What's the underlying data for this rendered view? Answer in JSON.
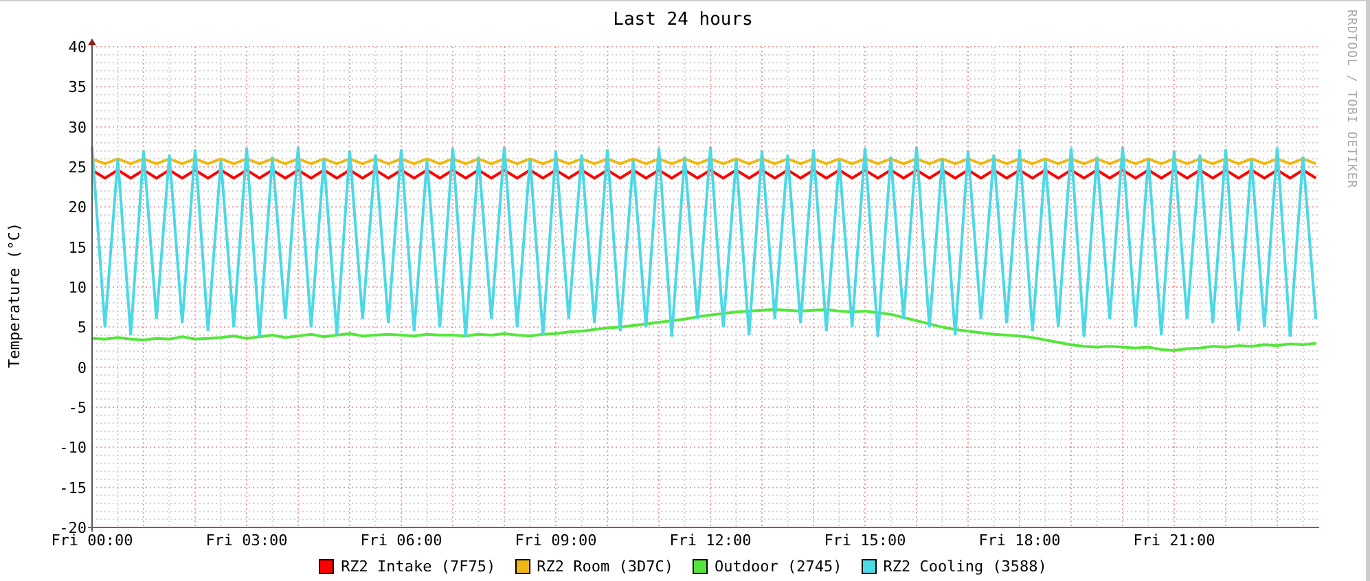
{
  "chart_data": {
    "type": "line",
    "grid": true,
    "title": "Last 24 hours",
    "ylabel": "Temperature (°C)",
    "ylim": [
      -20,
      40
    ],
    "yticks": [
      -20,
      -15,
      -10,
      -5,
      0,
      5,
      10,
      15,
      20,
      25,
      30,
      35,
      40
    ],
    "categories": [
      "Fri 00:00",
      null,
      null,
      null,
      null,
      null,
      null,
      null,
      null,
      null,
      null,
      null,
      "Fri 03:00",
      null,
      null,
      null,
      null,
      null,
      null,
      null,
      null,
      null,
      null,
      null,
      "Fri 06:00",
      null,
      null,
      null,
      null,
      null,
      null,
      null,
      null,
      null,
      null,
      null,
      "Fri 09:00",
      null,
      null,
      null,
      null,
      null,
      null,
      null,
      null,
      null,
      null,
      null,
      "Fri 12:00",
      null,
      null,
      null,
      null,
      null,
      null,
      null,
      null,
      null,
      null,
      null,
      "Fri 15:00",
      null,
      null,
      null,
      null,
      null,
      null,
      null,
      null,
      null,
      null,
      null,
      "Fri 18:00",
      null,
      null,
      null,
      null,
      null,
      null,
      null,
      null,
      null,
      null,
      null,
      "Fri 21:00",
      null,
      null,
      null,
      null,
      null,
      null,
      null,
      null,
      null,
      null,
      null
    ],
    "series": [
      {
        "name": "RZ2 Intake (7F75)",
        "color": "#ff0000",
        "values": [
          24.6,
          23.6,
          24.6,
          23.6,
          24.6,
          23.6,
          24.6,
          23.6,
          24.6,
          23.6,
          24.6,
          23.6,
          24.6,
          23.6,
          24.6,
          23.6,
          24.6,
          23.6,
          24.6,
          23.6,
          24.6,
          23.6,
          24.6,
          23.6,
          24.6,
          23.6,
          24.6,
          23.6,
          24.6,
          23.6,
          24.6,
          23.6,
          24.6,
          23.6,
          24.6,
          23.6,
          24.6,
          23.6,
          24.6,
          23.6,
          24.6,
          23.6,
          24.6,
          23.6,
          24.6,
          23.6,
          24.6,
          23.6,
          24.6,
          23.6,
          24.6,
          23.6,
          24.6,
          23.6,
          24.6,
          23.6,
          24.6,
          23.6,
          24.6,
          23.6,
          24.6,
          23.6,
          24.6,
          23.6,
          24.6,
          23.6,
          24.6,
          23.6,
          24.6,
          23.6,
          24.6,
          23.6,
          24.6,
          23.6,
          24.6,
          23.6,
          24.6,
          23.6,
          24.6,
          23.6,
          24.6,
          23.6,
          24.6,
          23.6,
          24.6,
          23.6,
          24.6,
          23.6,
          24.6,
          23.6,
          24.6,
          23.6,
          24.6,
          23.6,
          24.6,
          23.6
        ]
      },
      {
        "name": "RZ2 Room (3D7C)",
        "color": "#f0b814",
        "values": [
          26,
          25.4,
          26,
          25.4,
          26,
          25.4,
          26,
          25.4,
          26,
          25.4,
          26,
          25.4,
          26,
          25.4,
          26,
          25.4,
          26,
          25.4,
          26,
          25.4,
          26,
          25.4,
          26,
          25.4,
          26,
          25.4,
          26,
          25.4,
          26,
          25.4,
          26,
          25.4,
          26,
          25.4,
          26,
          25.4,
          26,
          25.4,
          26,
          25.4,
          26,
          25.4,
          26,
          25.4,
          26,
          25.4,
          26,
          25.4,
          26,
          25.4,
          26,
          25.4,
          26,
          25.4,
          26,
          25.4,
          26,
          25.4,
          26,
          25.4,
          26,
          25.4,
          26,
          25.4,
          26,
          25.4,
          26,
          25.4,
          26,
          25.4,
          26,
          25.4,
          26,
          25.4,
          26,
          25.4,
          26,
          25.4,
          26,
          25.4,
          26,
          25.4,
          26,
          25.4,
          26,
          25.4,
          26,
          25.4,
          26,
          25.4,
          26,
          25.4,
          26,
          25.4,
          26,
          25.4
        ]
      },
      {
        "name": "Outdoor (2745)",
        "color": "#55e63c",
        "values": [
          3.6,
          3.5,
          3.7,
          3.5,
          3.4,
          3.6,
          3.5,
          3.8,
          3.5,
          3.6,
          3.7,
          3.9,
          3.6,
          3.8,
          4,
          3.7,
          3.9,
          4.1,
          3.8,
          4,
          4.2,
          3.9,
          4,
          4.1,
          4,
          3.9,
          4.1,
          4,
          4,
          3.9,
          4.1,
          4,
          4.2,
          4,
          3.9,
          4.1,
          4.2,
          4.4,
          4.5,
          4.7,
          4.9,
          5,
          5.2,
          5.4,
          5.6,
          5.8,
          6,
          6.3,
          6.5,
          6.7,
          6.9,
          7,
          7.1,
          7.2,
          7.1,
          7,
          7.1,
          7.2,
          7,
          6.9,
          7,
          6.8,
          6.6,
          6.2,
          5.8,
          5.4,
          5,
          4.7,
          4.5,
          4.3,
          4.1,
          4,
          3.9,
          3.7,
          3.4,
          3.1,
          2.8,
          2.6,
          2.5,
          2.6,
          2.5,
          2.4,
          2.5,
          2.2,
          2.1,
          2.3,
          2.4,
          2.6,
          2.5,
          2.7,
          2.6,
          2.8,
          2.7,
          2.9,
          2.8,
          3
        ]
      },
      {
        "name": "RZ2 Cooling (3588)",
        "color": "#4dd8e6",
        "values": [
          27.5,
          5,
          26,
          4,
          27,
          6,
          26.5,
          5.5,
          27.2,
          4.5,
          25.8,
          5,
          27.4,
          3.8,
          26.3,
          6,
          27.5,
          5,
          26,
          4,
          27,
          6,
          26.5,
          5.5,
          27.2,
          4.5,
          25.8,
          5,
          27.4,
          3.8,
          26.3,
          6,
          27.5,
          5,
          26,
          4,
          27,
          6,
          26.5,
          5.5,
          27.2,
          4.5,
          25.8,
          5,
          27.4,
          3.8,
          26.3,
          6,
          27.5,
          5,
          26,
          4,
          27,
          6,
          26.5,
          5.5,
          27.2,
          4.5,
          25.8,
          5,
          27.4,
          3.8,
          26.3,
          6,
          27.5,
          5,
          26,
          4,
          27,
          6,
          26.5,
          5.5,
          27.2,
          4.5,
          25.8,
          5,
          27.4,
          3.8,
          26.3,
          6,
          27.5,
          5,
          26,
          4,
          27,
          6,
          26.5,
          5.5,
          27.2,
          4.5,
          25.8,
          5,
          27.4,
          3.8,
          26.3,
          6
        ]
      }
    ]
  },
  "credit": "RRDTOOL / TOBI OETIKER"
}
